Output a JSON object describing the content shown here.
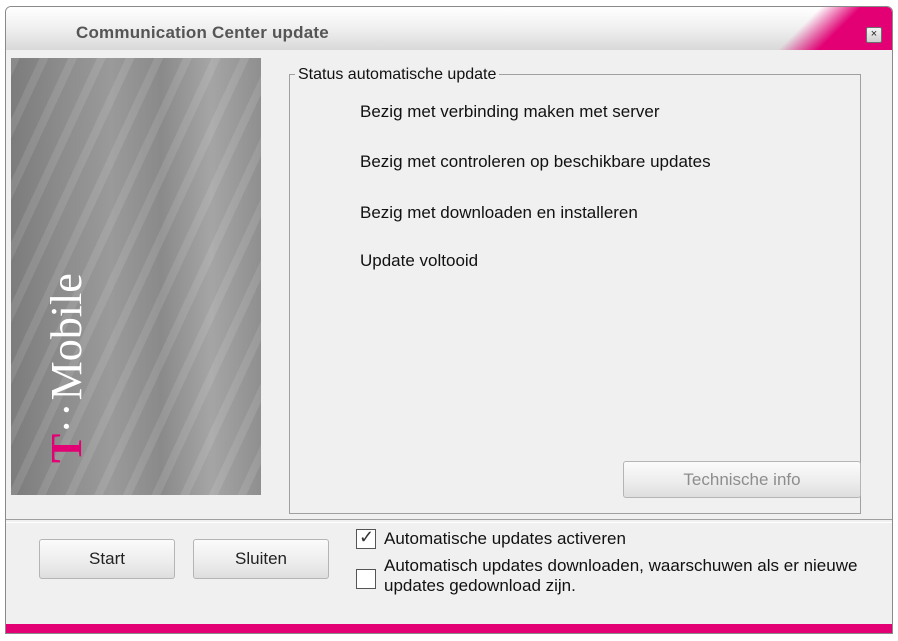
{
  "window": {
    "title": "Communication Center update",
    "close_symbol": "×"
  },
  "banner": {
    "logo_t": "T",
    "logo_dots": "··",
    "logo_text": "Mobile",
    "brand_color": "#e20074"
  },
  "status_group": {
    "legend": "Status automatische update",
    "items": [
      "Bezig met verbinding maken met server",
      "Bezig met controleren op beschikbare updates",
      "Bezig met downloaden en installeren",
      "Update voltooid"
    ]
  },
  "buttons": {
    "technical_info": "Technische info",
    "start": "Start",
    "close": "Sluiten"
  },
  "options": {
    "auto_updates_label": "Automatische updates activeren",
    "auto_updates_checked": true,
    "auto_download_label": "Automatisch updates downloaden, waarschuwen als er nieuwe updates gedownload zijn.",
    "auto_download_checked": false,
    "check_mark": "✓"
  }
}
